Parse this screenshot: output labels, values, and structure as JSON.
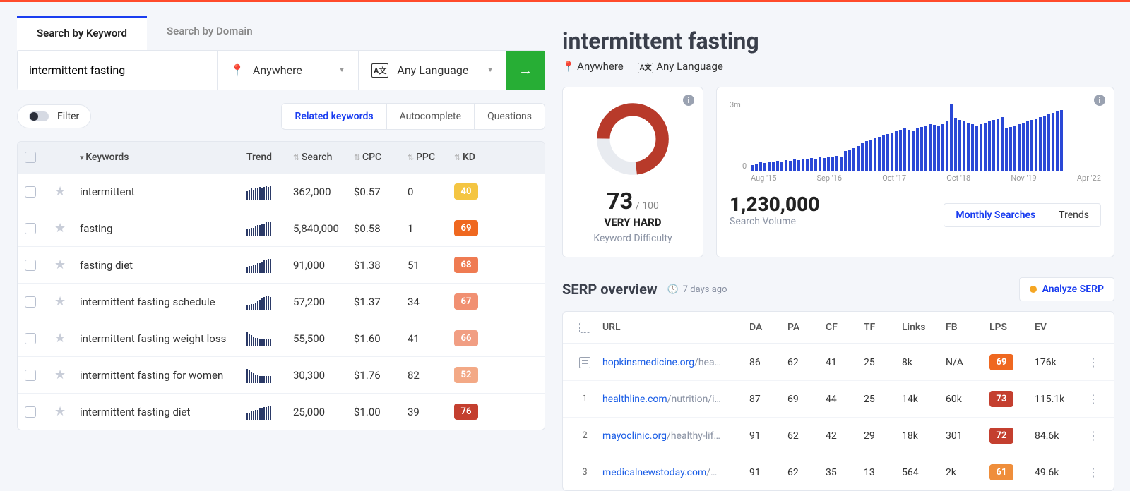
{
  "tabs": {
    "keyword": "Search by Keyword",
    "domain": "Search by Domain"
  },
  "search": {
    "query": "intermittent fasting",
    "location": "Anywhere",
    "language": "Any Language"
  },
  "filter_label": "Filter",
  "subtabs": {
    "related": "Related keywords",
    "auto": "Autocomplete",
    "questions": "Questions"
  },
  "columns": {
    "keywords": "Keywords",
    "trend": "Trend",
    "search": "Search",
    "cpc": "CPC",
    "ppc": "PPC",
    "kd": "KD"
  },
  "rows": [
    {
      "kw": "intermittent",
      "search": "362,000",
      "cpc": "$0.57",
      "ppc": "0",
      "kd": "40",
      "kd_color": "#f4c542",
      "spark": [
        6,
        7,
        8,
        7,
        8,
        8,
        9,
        8,
        9,
        10,
        9,
        10
      ]
    },
    {
      "kw": "fasting",
      "search": "5,840,000",
      "cpc": "$0.58",
      "ppc": "1",
      "kd": "69",
      "kd_color": "#ef6820",
      "spark": [
        5,
        5,
        6,
        6,
        7,
        8,
        8,
        9,
        9,
        10,
        10,
        10
      ]
    },
    {
      "kw": "fasting diet",
      "search": "91,000",
      "cpc": "$1.38",
      "ppc": "51",
      "kd": "68",
      "kd_color": "#ef7b52",
      "spark": [
        4,
        5,
        5,
        6,
        6,
        7,
        7,
        8,
        9,
        9,
        10,
        10
      ]
    },
    {
      "kw": "intermittent fasting schedule",
      "search": "57,200",
      "cpc": "$1.37",
      "ppc": "34",
      "kd": "67",
      "kd_color": "#f19072",
      "spark": [
        3,
        3,
        4,
        4,
        5,
        6,
        7,
        8,
        9,
        10,
        10,
        9
      ]
    },
    {
      "kw": "intermittent fasting weight loss",
      "search": "55,500",
      "cpc": "$1.60",
      "ppc": "41",
      "kd": "66",
      "kd_color": "#f19e83",
      "spark": [
        10,
        9,
        8,
        7,
        6,
        6,
        5,
        5,
        5,
        5,
        5,
        5
      ]
    },
    {
      "kw": "intermittent fasting for women",
      "search": "30,300",
      "cpc": "$1.76",
      "ppc": "82",
      "kd": "52",
      "kd_color": "#f3a986",
      "spark": [
        10,
        9,
        8,
        7,
        6,
        6,
        5,
        5,
        5,
        5,
        5,
        5
      ]
    },
    {
      "kw": "intermittent fasting diet",
      "search": "25,000",
      "cpc": "$1.00",
      "ppc": "39",
      "kd": "76",
      "kd_color": "#c43f2f",
      "spark": [
        5,
        5,
        6,
        6,
        7,
        7,
        8,
        8,
        9,
        9,
        10,
        10
      ]
    }
  ],
  "detail": {
    "title": "intermittent fasting",
    "location": "Anywhere",
    "language": "Any Language",
    "kd": {
      "score": "73",
      "outof": "/ 100",
      "label": "VERY HARD",
      "desc": "Keyword Difficulty",
      "pct": 73
    },
    "volume": {
      "value": "1,230,000",
      "label": "Search Volume",
      "ymax": "3m",
      "xticks": [
        "Aug '15",
        "Sep '16",
        "Oct '17",
        "Oct '18",
        "Nov '19",
        "Apr '22"
      ],
      "bars": [
        8,
        10,
        12,
        11,
        13,
        12,
        14,
        13,
        15,
        14,
        16,
        15,
        17,
        16,
        18,
        17,
        19,
        18,
        20,
        19,
        21,
        20,
        28,
        30,
        32,
        35,
        40,
        42,
        44,
        46,
        48,
        50,
        52,
        54,
        56,
        58,
        60,
        58,
        56,
        60,
        62,
        64,
        66,
        65,
        64,
        66,
        70,
        95,
        75,
        72,
        70,
        68,
        66,
        64,
        66,
        68,
        70,
        72,
        74,
        76,
        60,
        62,
        64,
        66,
        68,
        70,
        72,
        74,
        76,
        78,
        80,
        82,
        84,
        86
      ]
    },
    "seg": {
      "monthly": "Monthly Searches",
      "trends": "Trends"
    }
  },
  "serp": {
    "title": "SERP overview",
    "ago": "7 days ago",
    "analyze": "Analyze SERP",
    "cols": {
      "url": "URL",
      "da": "DA",
      "pa": "PA",
      "cf": "CF",
      "tf": "TF",
      "links": "Links",
      "fb": "FB",
      "lps": "LPS",
      "ev": "EV"
    },
    "rows": [
      {
        "pos": "",
        "feat": true,
        "domain": "hopkinsmedicine.org",
        "path": "/hea…",
        "da": "86",
        "pa": "62",
        "cf": "41",
        "tf": "25",
        "links": "8k",
        "fb": "N/A",
        "lps": "69",
        "lps_color": "#ef6820",
        "ev": "176k"
      },
      {
        "pos": "1",
        "domain": "healthline.com",
        "path": "/nutrition/i…",
        "da": "87",
        "pa": "69",
        "cf": "44",
        "tf": "25",
        "links": "14k",
        "fb": "60k",
        "lps": "73",
        "lps_color": "#c43f2f",
        "ev": "115.1k"
      },
      {
        "pos": "2",
        "domain": "mayoclinic.org",
        "path": "/healthy-lif…",
        "da": "91",
        "pa": "62",
        "cf": "42",
        "tf": "29",
        "links": "18k",
        "fb": "301",
        "lps": "72",
        "lps_color": "#c43f2f",
        "ev": "84.6k"
      },
      {
        "pos": "3",
        "domain": "medicalnewstoday.com",
        "path": "/…",
        "da": "91",
        "pa": "62",
        "cf": "35",
        "tf": "13",
        "links": "564",
        "fb": "2k",
        "lps": "61",
        "lps_color": "#ef8e3b",
        "ev": "49.6k"
      }
    ]
  }
}
